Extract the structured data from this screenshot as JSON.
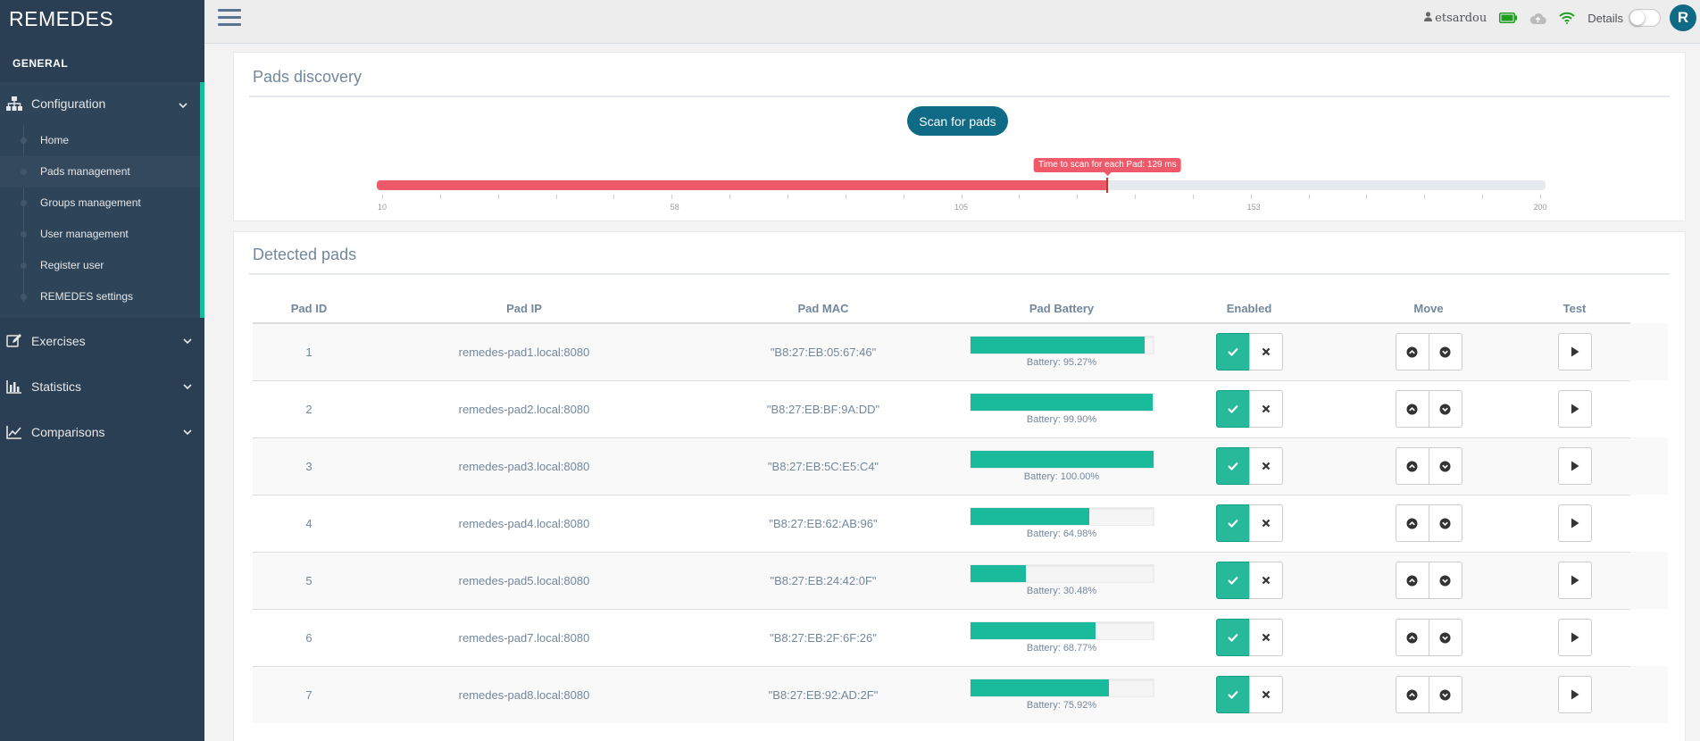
{
  "sidebar": {
    "brand": "REMEDES",
    "section_title": "GENERAL",
    "groups": [
      {
        "label": "Configuration",
        "icon": "sitemap-icon"
      },
      {
        "label": "Exercises",
        "icon": "edit-icon"
      },
      {
        "label": "Statistics",
        "icon": "bar-chart-icon"
      },
      {
        "label": "Comparisons",
        "icon": "line-chart-icon"
      }
    ],
    "config_items": [
      "Home",
      "Pads management",
      "Groups management",
      "User management",
      "Register user",
      "REMEDES settings"
    ],
    "current_item": "Pads management"
  },
  "topbar": {
    "username": "etsardou",
    "details_label": "Details",
    "avatar_letter": "R",
    "icons": [
      "user-icon",
      "battery-icon",
      "cloud-upload-icon",
      "wifi-icon"
    ]
  },
  "discovery": {
    "title": "Pads discovery",
    "scan_button": "Scan for pads",
    "slider_tooltip": "Time to scan for each Pad: 129 ms",
    "slider_min": 10,
    "slider_max": 200,
    "slider_value": 129,
    "tick_labels": [
      "10",
      "58",
      "105",
      "153",
      "200"
    ]
  },
  "detected": {
    "title": "Detected pads",
    "columns": [
      "Pad ID",
      "Pad IP",
      "Pad MAC",
      "Pad Battery",
      "Enabled",
      "Move",
      "Test"
    ],
    "rows": [
      {
        "id": "1",
        "ip": "remedes-pad1.local:8080",
        "mac": "\"B8:27:EB:05:67:46\"",
        "battery": 95.27,
        "battery_text": "Battery: 95.27%"
      },
      {
        "id": "2",
        "ip": "remedes-pad2.local:8080",
        "mac": "\"B8:27:EB:BF:9A:DD\"",
        "battery": 99.9,
        "battery_text": "Battery: 99.90%"
      },
      {
        "id": "3",
        "ip": "remedes-pad3.local:8080",
        "mac": "\"B8:27:EB:5C:E5:C4\"",
        "battery": 100.0,
        "battery_text": "Battery: 100.00%"
      },
      {
        "id": "4",
        "ip": "remedes-pad4.local:8080",
        "mac": "\"B8:27:EB:62:AB:96\"",
        "battery": 64.98,
        "battery_text": "Battery: 64.98%"
      },
      {
        "id": "5",
        "ip": "remedes-pad5.local:8080",
        "mac": "\"B8:27:EB:24:42:0F\"",
        "battery": 30.48,
        "battery_text": "Battery: 30.48%"
      },
      {
        "id": "6",
        "ip": "remedes-pad7.local:8080",
        "mac": "\"B8:27:EB:2F:6F:26\"",
        "battery": 68.77,
        "battery_text": "Battery: 68.77%"
      },
      {
        "id": "7",
        "ip": "remedes-pad8.local:8080",
        "mac": "\"B8:27:EB:92:AD:2F\"",
        "battery": 75.92,
        "battery_text": "Battery: 75.92%"
      }
    ]
  },
  "colors": {
    "sidebar_bg": "#2a3f54",
    "accent": "#1abb9c",
    "primary_button": "#0e6a85",
    "slider_fill": "#ef5a6a"
  }
}
